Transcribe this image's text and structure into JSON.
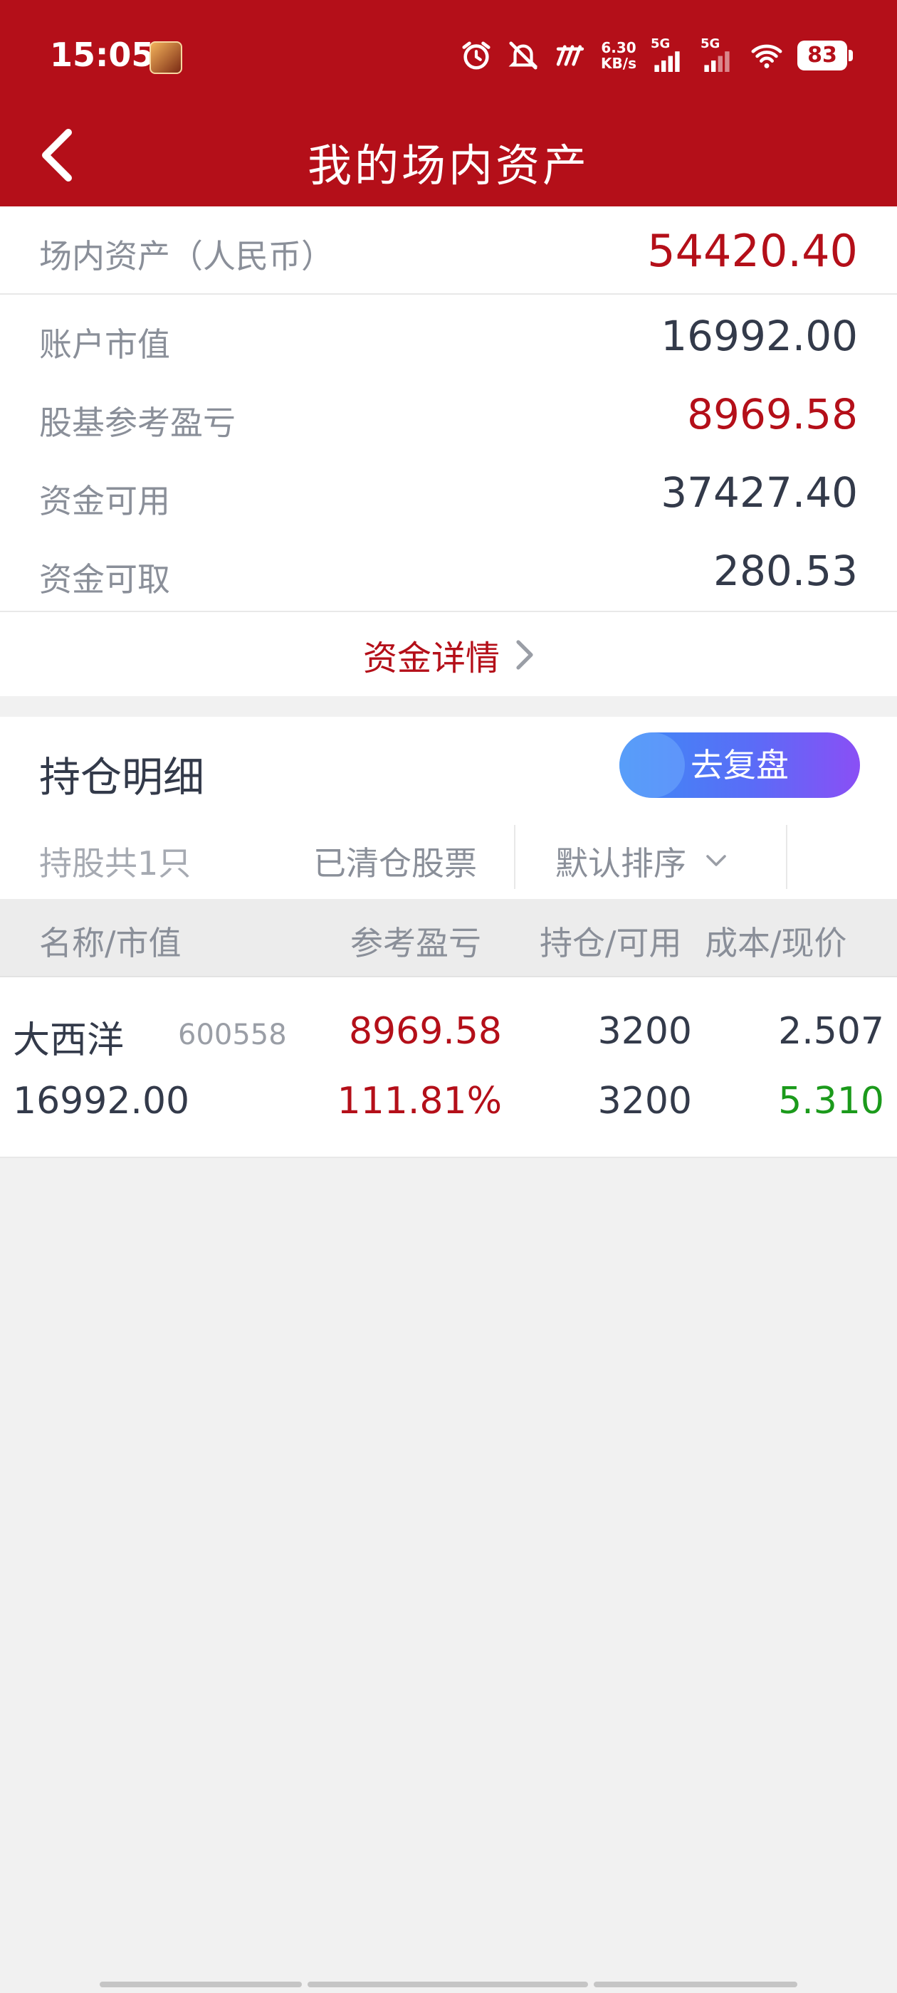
{
  "status_bar": {
    "time": "15:05",
    "speed_value": "6.30",
    "speed_unit": "KB/s",
    "sim1": "5G",
    "sim2": "5G",
    "battery": "83",
    "icons": [
      "alarm-icon",
      "mute-icon",
      "signal-brand-icon",
      "signal-icon",
      "wifi-icon"
    ]
  },
  "header": {
    "title": "我的场内资产",
    "back_icon": "chevron-left-icon"
  },
  "assets": {
    "total_label": "场内资产（人民币）",
    "total_value": "54420.40",
    "rows": [
      {
        "label": "账户市值",
        "value": "16992.00"
      },
      {
        "label": "股基参考盈亏",
        "value": "8969.58"
      },
      {
        "label": "资金可用",
        "value": "37427.40"
      },
      {
        "label": "资金可取",
        "value": "280.53"
      }
    ],
    "detail_link": "资金详情"
  },
  "holdings": {
    "title": "持仓明细",
    "review_button": "去复盘",
    "count_text": "持股共1只",
    "cleared_link": "已清仓股票",
    "sort_label": "默认排序",
    "columns": [
      "名称/市值",
      "参考盈亏",
      "持仓/可用",
      "成本/现价"
    ],
    "items": [
      {
        "name": "大西洋",
        "code": "600558",
        "market_value": "16992.00",
        "profit": "8969.58",
        "profit_pct": "111.81%",
        "position": "3200",
        "available": "3200",
        "cost": "2.507",
        "price": "5.310"
      }
    ]
  },
  "colors": {
    "brand_red": "#b40f19",
    "gain_red": "#b40f19",
    "loss_green": "#1b9a1b",
    "review_gradient_start": "#3d8cf5",
    "review_gradient_end": "#8a4ff5"
  }
}
